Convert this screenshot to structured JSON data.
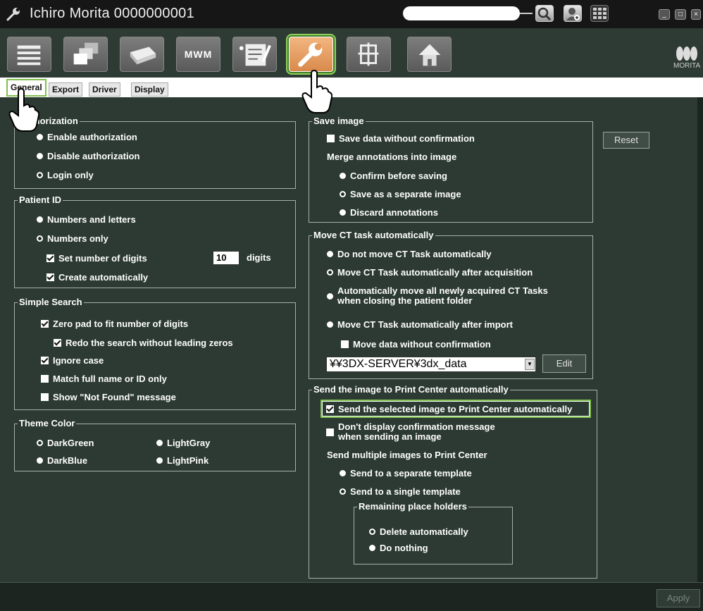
{
  "window": {
    "title": "Ichiro Morita 0000000001",
    "search_placeholder": ""
  },
  "toolbar": {
    "items": [
      "list-icon",
      "windows-icon",
      "printer-icon",
      "MWM",
      "notes-icon",
      "wrench-icon",
      "frames-icon",
      "home-icon"
    ],
    "mwm_label": "MWM",
    "brand": "MORITA"
  },
  "tabs": [
    "General",
    "Export",
    "Driver",
    "Display"
  ],
  "authorization": {
    "title": "Authorization",
    "options": [
      "Enable authorization",
      "Disable authorization",
      "Login only"
    ],
    "selected": "Login only"
  },
  "patient_id": {
    "title": "Patient ID",
    "options": [
      "Numbers and letters",
      "Numbers only"
    ],
    "selected": "Numbers only",
    "set_digits_label": "Set number of digits",
    "digits_value": "10",
    "digits_unit": "digits",
    "create_auto_label": "Create automatically"
  },
  "simple_search": {
    "title": "Simple Search",
    "zero_pad": "Zero pad to fit number of digits",
    "redo": "Redo the search without leading zeros",
    "ignore_case": "Ignore case",
    "match_full": "Match full name or ID only",
    "show_not_found": "Show \"Not Found\" message"
  },
  "theme_color": {
    "title": "Theme Color",
    "options": [
      "DarkGreen",
      "LightGray",
      "DarkBlue",
      "LightPink"
    ],
    "selected": "DarkGreen"
  },
  "save_image": {
    "title": "Save image",
    "save_without_confirm": "Save data without confirmation",
    "merge_label": "Merge annotations into image",
    "options": [
      "Confirm before saving",
      "Save as a separate image",
      "Discard annotations"
    ],
    "selected": "Save as a separate image",
    "reset_button": "Reset"
  },
  "move_ct": {
    "title": "Move CT task automatically",
    "opt1": "Do not move CT Task automatically",
    "opt2": "Move CT Task automatically after acquisition",
    "opt3_line1": "Automatically move all newly acquired CT Tasks",
    "opt3_line2": "when closing the patient folder",
    "opt4": "Move CT Task automatically after import",
    "selected": "Move CT Task automatically after acquisition",
    "move_without_confirm": "Move data without confirmation",
    "path": "¥¥3DX-SERVER¥3dx_data",
    "edit_button": "Edit"
  },
  "print_center": {
    "title": "Send the image to Print Center automatically",
    "send_selected": "Send the selected image to Print Center automatically",
    "dont_display_line1": "Don't display confirmation message",
    "dont_display_line2": "when sending an image",
    "multiple_label": "Send multiple images to Print Center",
    "options": [
      "Send to a separate template",
      "Send to a single template"
    ],
    "selected": "Send to a single template",
    "remaining_title": "Remaining place holders",
    "remaining_options": [
      "Delete automatically",
      "Do nothing"
    ],
    "remaining_selected": "Delete automatically"
  },
  "footer": {
    "apply_button": "Apply"
  },
  "colors": {
    "panel_bg": "#2c3a33",
    "highlight": "#7fc04d",
    "active_tool": "#e39a5a"
  }
}
